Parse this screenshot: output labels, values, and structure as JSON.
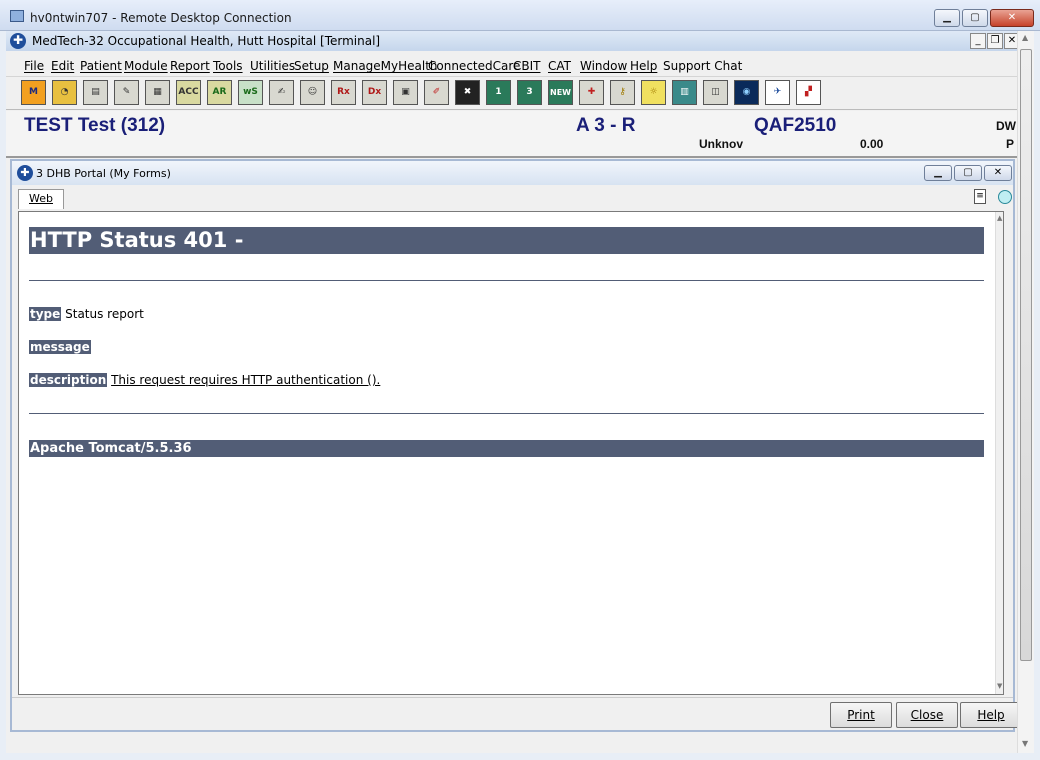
{
  "rdp": {
    "title": "hv0ntwin707 - Remote Desktop Connection",
    "min": "▁",
    "max": "▢",
    "close": "✕"
  },
  "app": {
    "title": "MedTech-32  Occupational Health, Hutt Hospital  [Terminal]",
    "min": "_",
    "restore": "❐",
    "close": "✕"
  },
  "menu": [
    "File",
    "Edit",
    "Patient",
    "Module",
    "Report",
    "Tools",
    "Utilities",
    "Setup",
    "ManageMyHealth",
    "ConnectedCare",
    "CBIT",
    "CAT",
    "Window",
    "Help",
    "Support Chat"
  ],
  "toolbar": [
    "M",
    "◔",
    "▤",
    "✎",
    "▦",
    "ACC",
    "AR",
    "wS",
    "✍",
    "☺",
    "Rx",
    "Dx",
    "▣",
    "✐",
    "✖",
    "1",
    "3",
    "NEW",
    "✚",
    "⚷",
    "☼",
    "▥",
    "◫",
    "◉",
    "✈",
    "▞"
  ],
  "patient": {
    "name": "TEST Test (312)",
    "code": "A 3 -  R",
    "id": "QAF2510",
    "unknown": "Unknov",
    "balance": "0.00",
    "right_top": "DW",
    "right_bottom": "P"
  },
  "child": {
    "title": "3 DHB Portal (My Forms)",
    "tab": "Web"
  },
  "page": {
    "heading": "HTTP Status 401 -",
    "type_label": "type",
    "type_value": "Status report",
    "message_label": "message",
    "description_label": "description",
    "description_value": "This request requires HTTP authentication ().",
    "footer": "Apache Tomcat/5.5.36"
  },
  "buttons": {
    "print": "Print",
    "close": "Close",
    "help": "Help"
  },
  "colors": {
    "tomcat_header": "#525d76",
    "patient_text": "#1a1f78"
  }
}
